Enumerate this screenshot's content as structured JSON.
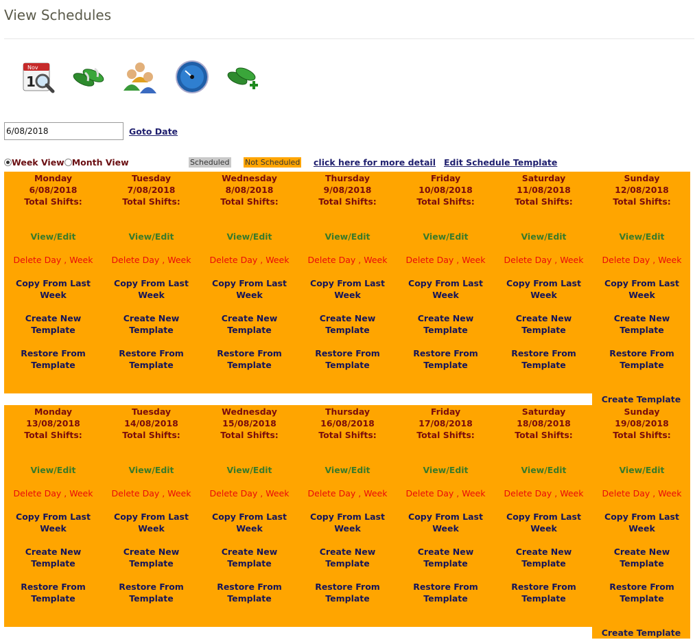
{
  "page": {
    "title": "View Schedules"
  },
  "toolbar": {
    "icons": [
      {
        "name": "calendar-search-icon"
      },
      {
        "name": "sandals-icon"
      },
      {
        "name": "staff-group-icon"
      },
      {
        "name": "dashboard-gauge-icon"
      },
      {
        "name": "sandals-add-icon"
      }
    ]
  },
  "date_nav": {
    "value": "6/08/2018",
    "goto_label": "Goto Date"
  },
  "view_mode": {
    "week_label": "Week View",
    "month_label": "Month View",
    "selected": "week"
  },
  "legend": {
    "scheduled": "Scheduled",
    "not_scheduled": "Not Scheduled"
  },
  "links": {
    "more_detail": "click here for more detail",
    "edit_template": "Edit Schedule Template"
  },
  "colors": {
    "not_scheduled": "#ffa500",
    "scheduled": "#c9c9c9"
  },
  "labels": {
    "total_shifts": "Total Shifts:",
    "view_edit": "View/Edit",
    "delete": "Delete Day , Week",
    "copy": "Copy From Last Week",
    "create_new": "Create New Template",
    "restore": "Restore From Template",
    "create_template": "Create Template"
  },
  "weeks": [
    {
      "days": [
        {
          "day": "Monday",
          "date": "6/08/2018"
        },
        {
          "day": "Tuesday",
          "date": "7/08/2018"
        },
        {
          "day": "Wednesday",
          "date": "8/08/2018"
        },
        {
          "day": "Thursday",
          "date": "9/08/2018"
        },
        {
          "day": "Friday",
          "date": "10/08/2018"
        },
        {
          "day": "Saturday",
          "date": "11/08/2018"
        },
        {
          "day": "Sunday",
          "date": "12/08/2018"
        }
      ]
    },
    {
      "days": [
        {
          "day": "Monday",
          "date": "13/08/2018"
        },
        {
          "day": "Tuesday",
          "date": "14/08/2018"
        },
        {
          "day": "Wednesday",
          "date": "15/08/2018"
        },
        {
          "day": "Thursday",
          "date": "16/08/2018"
        },
        {
          "day": "Friday",
          "date": "17/08/2018"
        },
        {
          "day": "Saturday",
          "date": "18/08/2018"
        },
        {
          "day": "Sunday",
          "date": "19/08/2018"
        }
      ]
    }
  ]
}
